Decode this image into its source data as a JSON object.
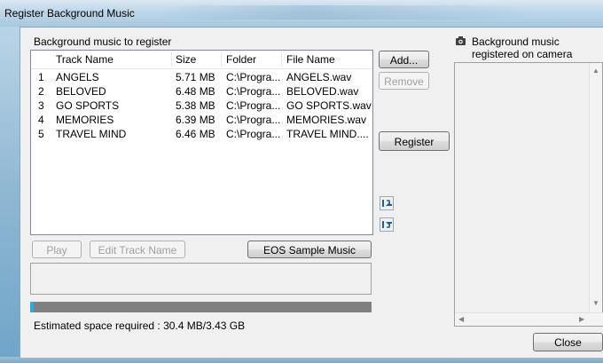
{
  "window": {
    "title": "Register Background Music"
  },
  "left_panel": {
    "heading": "Background music to register",
    "columns": [
      "Track Name",
      "Size",
      "Folder",
      "File Name"
    ],
    "rows": [
      {
        "num": "1",
        "track": "ANGELS",
        "size": "5.71 MB",
        "folder": "C:\\Progra...",
        "file": "ANGELS.wav"
      },
      {
        "num": "2",
        "track": "BELOVED",
        "size": "6.48 MB",
        "folder": "C:\\Progra...",
        "file": "BELOVED.wav"
      },
      {
        "num": "3",
        "track": "GO SPORTS",
        "size": "5.38 MB",
        "folder": "C:\\Progra...",
        "file": "GO SPORTS.wav"
      },
      {
        "num": "4",
        "track": "MEMORIES",
        "size": "6.39 MB",
        "folder": "C:\\Progra...",
        "file": "MEMORIES.wav"
      },
      {
        "num": "5",
        "track": "TRAVEL MIND",
        "size": "6.46 MB",
        "folder": "C:\\Progra...",
        "file": "TRAVEL MIND...."
      }
    ],
    "play_label": "Play",
    "edit_label": "Edit Track Name",
    "sample_label": "EOS Sample Music",
    "progress_fraction": 0.01,
    "estimate_text": "Estimated space required : 30.4 MB/3.43 GB"
  },
  "middle": {
    "add_label": "Add...",
    "remove_label": "Remove",
    "register_label": "Register",
    "move_up_icon": "move-up-icon",
    "move_down_icon": "move-down-icon"
  },
  "right_panel": {
    "heading_line1": "Background music",
    "heading_line2": "registered on camera",
    "camera_icon": "camera-icon",
    "close_label": "Close"
  },
  "colors": {
    "progress_fill": "#2ea8e0",
    "progress_track": "#808080"
  }
}
